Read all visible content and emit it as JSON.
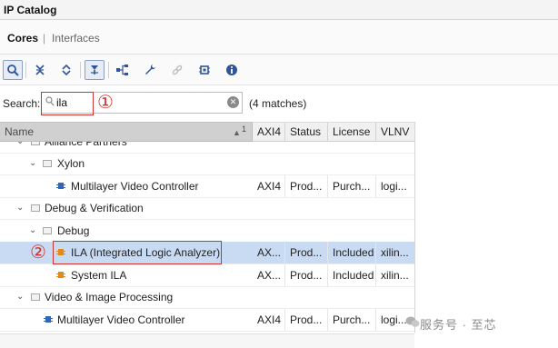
{
  "window": {
    "title": "IP Catalog"
  },
  "tabs": [
    {
      "label": "Cores",
      "active": true
    },
    {
      "label": "Interfaces",
      "active": false
    }
  ],
  "tab_separator": "|",
  "toolbar": {
    "buttons": [
      {
        "icon": "search-icon",
        "selected": true
      },
      {
        "icon": "collapse-all-icon"
      },
      {
        "icon": "expand-all-icon"
      },
      {
        "icon": "filter-icon",
        "selected": true
      },
      {
        "icon": "hierarchy-icon"
      },
      {
        "icon": "wrench-icon"
      },
      {
        "icon": "link-icon",
        "disabled": true
      },
      {
        "icon": "chip-settings-icon"
      },
      {
        "icon": "info-icon"
      }
    ]
  },
  "search": {
    "label": "Search:",
    "value": "ila",
    "matches": "(4 matches)"
  },
  "annotations": {
    "mark1": "①",
    "mark2": "②"
  },
  "table": {
    "columns": [
      "Name",
      "AXI4",
      "Status",
      "License",
      "VLNV"
    ],
    "sort_indicator": "1",
    "rows": [
      {
        "name": "Alliance Partners",
        "type": "folder",
        "level": 0,
        "partial": true
      },
      {
        "name": "Xylon",
        "type": "folder",
        "level": 1,
        "expander": "⌄"
      },
      {
        "name": "Multilayer Video Controller",
        "type": "ip",
        "level": 2,
        "axi4": "AXI4",
        "status": "Prod...",
        "license": "Purch...",
        "vlnv": "logi..."
      },
      {
        "name": "Debug & Verification",
        "type": "folder",
        "level": 0,
        "expander": "⌄"
      },
      {
        "name": "Debug",
        "type": "folder",
        "level": 1,
        "expander": "⌄"
      },
      {
        "name": "ILA (Integrated Logic Analyzer)",
        "type": "ip",
        "level": 2,
        "selected": true,
        "axi4": "AX...",
        "status": "Prod...",
        "license": "Included",
        "vlnv": "xilin..."
      },
      {
        "name": "System ILA",
        "type": "ip",
        "level": 2,
        "axi4": "AX...",
        "status": "Prod...",
        "license": "Included",
        "vlnv": "xilin..."
      },
      {
        "name": "Video & Image Processing",
        "type": "folder",
        "level": 0,
        "expander": "⌄"
      },
      {
        "name": "Multilayer Video Controller",
        "type": "ip",
        "level": 1,
        "axi4": "AXI4",
        "status": "Prod...",
        "license": "Purch...",
        "vlnv": "logi..."
      }
    ]
  },
  "watermark": "服务号 · 至芯"
}
